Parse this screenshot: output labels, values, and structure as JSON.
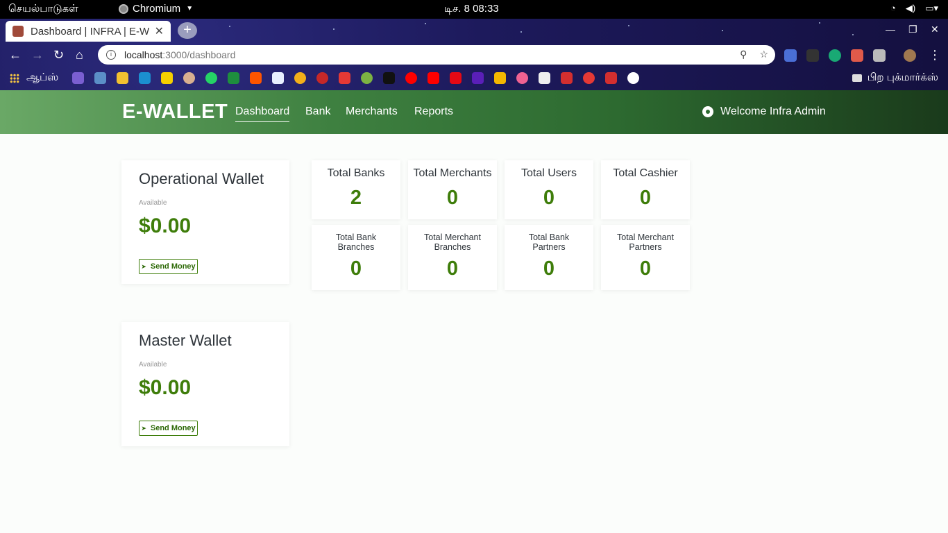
{
  "os": {
    "activities": "செயல்பாடுகள்",
    "app_name": "Chromium",
    "clock": "டிச. 8  08:33",
    "tray": [
      "wifi-icon",
      "volume-icon",
      "battery-icon"
    ]
  },
  "browser": {
    "tab_title": "Dashboard | INFRA | E-W",
    "url_host": "localhost",
    "url_path": ":3000/dashboard",
    "apps_label": "ஆப்ஸ்",
    "other_bookmarks": "பிற புக்மார்க்ஸ்"
  },
  "header": {
    "brand": "E-WALLET",
    "nav": [
      "Dashboard",
      "Bank",
      "Merchants",
      "Reports"
    ],
    "active_nav": "Dashboard",
    "welcome": "Welcome Infra Admin"
  },
  "wallets": [
    {
      "title": "Operational Wallet",
      "sublabel": "Available",
      "amount": "$0.00",
      "button": "Send Money"
    },
    {
      "title": "Master Wallet",
      "sublabel": "Available",
      "amount": "$0.00",
      "button": "Send Money"
    }
  ],
  "stats_top": [
    {
      "label": "Total Banks",
      "value": "2"
    },
    {
      "label": "Total Merchants",
      "value": "0"
    },
    {
      "label": "Total Users",
      "value": "0"
    },
    {
      "label": "Total Cashier",
      "value": "0"
    }
  ],
  "stats_bottom": [
    {
      "label_1": "Total Bank",
      "label_2": "Branches",
      "value": "0"
    },
    {
      "label_1": "Total Merchant",
      "label_2": "Branches",
      "value": "0"
    },
    {
      "label_1": "Total Bank",
      "label_2": "Partners",
      "value": "0"
    },
    {
      "label_1": "Total Merchant",
      "label_2": "Partners",
      "value": "0"
    }
  ],
  "colors": {
    "accent_green": "#3e7d0a",
    "header_start": "#6aa866",
    "header_end": "#1a3a1b"
  }
}
